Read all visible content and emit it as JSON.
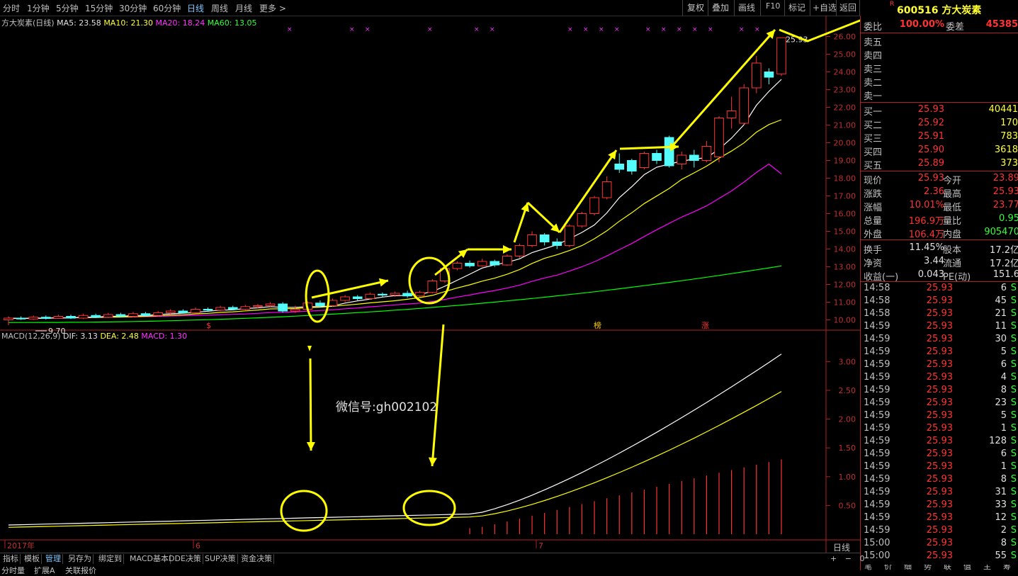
{
  "topbar": {
    "periods": [
      "分时",
      "1分钟",
      "5分钟",
      "15分钟",
      "30分钟",
      "60分钟",
      "日线",
      "周线",
      "月线",
      "更多 >"
    ],
    "active_period": "日线",
    "tools": [
      "复权",
      "叠加",
      "画线",
      "F10",
      "标记",
      "+自选",
      "返回"
    ],
    "stock_title": "600516 方大炭素",
    "r_marker": "R"
  },
  "price_legend": {
    "name": "方大炭素(日线)",
    "ma5": "MA5: 23.58",
    "ma10": "MA10: 21.30",
    "ma20": "MA20: 18.24",
    "ma60": "MA60: 13.05",
    "low_label": "9.70",
    "high_label": "25.93"
  },
  "macd_legend": {
    "name": "MACD(12,26,9)",
    "dif": "DIF: 3.13",
    "dea": "DEA: 2.48",
    "macd": "MACD: 1.30"
  },
  "price_axis": [
    "26.00",
    "25.00",
    "24.00",
    "23.00",
    "22.00",
    "21.00",
    "20.00",
    "19.00",
    "18.00",
    "17.00",
    "16.00",
    "15.00",
    "14.00",
    "13.00",
    "12.00",
    "11.00",
    "10.00"
  ],
  "macd_axis": [
    "3.00",
    "2.50",
    "2.00",
    "1.50",
    "1.00",
    "0.50"
  ],
  "date_labels": [
    "2017年",
    "6",
    "7"
  ],
  "period_corner": "日线",
  "event_markers": [
    "$",
    "榜",
    "涨"
  ],
  "watermark": "微信号:gh002102",
  "colors": {
    "up": "#ff3232",
    "down": "#54fcfc",
    "ma5": "#ffffff",
    "ma10": "#ffff00",
    "ma20": "#ff00ff",
    "ma60": "#00ff00",
    "annotation": "#ffff00"
  },
  "order_book": {
    "weibi_label": "委比",
    "weibi_value": "100.00%",
    "weicha_label": "委差",
    "weicha_value": "45385",
    "sell": [
      {
        "label": "卖五"
      },
      {
        "label": "卖四"
      },
      {
        "label": "卖三"
      },
      {
        "label": "卖二"
      },
      {
        "label": "卖一"
      }
    ],
    "buy": [
      {
        "label": "买一",
        "price": "25.93",
        "vol": "40441"
      },
      {
        "label": "买二",
        "price": "25.92",
        "vol": "170"
      },
      {
        "label": "买三",
        "price": "25.91",
        "vol": "783"
      },
      {
        "label": "买四",
        "price": "25.90",
        "vol": "3618"
      },
      {
        "label": "买五",
        "price": "25.89",
        "vol": "373"
      }
    ]
  },
  "quote": [
    {
      "l1": "现价",
      "v1": "25.93",
      "l2": "今开",
      "v2": "23.89"
    },
    {
      "l1": "涨跌",
      "v1": "2.36",
      "l2": "最高",
      "v2": "25.93"
    },
    {
      "l1": "涨幅",
      "v1": "10.01%",
      "l2": "最低",
      "v2": "23.77"
    },
    {
      "l1": "总量",
      "v1": "196.9万",
      "l2": "量比",
      "v2": "0.95"
    },
    {
      "l1": "外盘",
      "v1": "106.4万",
      "l2": "内盘",
      "v2": "905470"
    }
  ],
  "fundamentals": [
    {
      "l1": "换手",
      "v1": "11.45%",
      "l2": "股本",
      "v2": "17.2亿"
    },
    {
      "l1": "净资",
      "v1": "3.44",
      "l2": "流通",
      "v2": "17.2亿"
    },
    {
      "l1": "收益(一)",
      "v1": "0.043",
      "l2": "PE(动)",
      "v2": "151.6"
    }
  ],
  "ticks": [
    {
      "time": "14:58",
      "price": "25.93",
      "vol": "6",
      "side": "S"
    },
    {
      "time": "14:58",
      "price": "25.93",
      "vol": "45",
      "side": "S"
    },
    {
      "time": "14:58",
      "price": "25.93",
      "vol": "21",
      "side": "S"
    },
    {
      "time": "14:59",
      "price": "25.93",
      "vol": "11",
      "side": "S"
    },
    {
      "time": "14:59",
      "price": "25.93",
      "vol": "30",
      "side": "S"
    },
    {
      "time": "14:59",
      "price": "25.93",
      "vol": "5",
      "side": "S"
    },
    {
      "time": "14:59",
      "price": "25.93",
      "vol": "6",
      "side": "S"
    },
    {
      "time": "14:59",
      "price": "25.93",
      "vol": "4",
      "side": "S"
    },
    {
      "time": "14:59",
      "price": "25.93",
      "vol": "8",
      "side": "S"
    },
    {
      "time": "14:59",
      "price": "25.93",
      "vol": "23",
      "side": "S"
    },
    {
      "time": "14:59",
      "price": "25.93",
      "vol": "5",
      "side": "S"
    },
    {
      "time": "14:59",
      "price": "25.93",
      "vol": "1",
      "side": "S"
    },
    {
      "time": "14:59",
      "price": "25.93",
      "vol": "128",
      "side": "S"
    },
    {
      "time": "14:59",
      "price": "25.93",
      "vol": "6",
      "side": "S"
    },
    {
      "time": "14:59",
      "price": "25.93",
      "vol": "1",
      "side": "S"
    },
    {
      "time": "14:59",
      "price": "25.93",
      "vol": "8",
      "side": "S"
    },
    {
      "time": "14:59",
      "price": "25.93",
      "vol": "31",
      "side": "S"
    },
    {
      "time": "14:59",
      "price": "25.93",
      "vol": "33",
      "side": "S"
    },
    {
      "time": "14:59",
      "price": "25.93",
      "vol": "12",
      "side": "S"
    },
    {
      "time": "14:59",
      "price": "25.93",
      "vol": "2",
      "side": "S"
    },
    {
      "time": "15:00",
      "price": "25.93",
      "vol": "8",
      "side": "S"
    },
    {
      "time": "15:00",
      "price": "25.93",
      "vol": "55",
      "side": "S"
    }
  ],
  "bottom_tabs": [
    "指标",
    "模板",
    "管理",
    "另存为",
    "绑定到",
    "MACD基本",
    "DDE决策",
    "SUP决策",
    "资金决策"
  ],
  "bottom_active": "管理",
  "bottom_row2": [
    "分时量",
    "扩展A",
    "关联报价"
  ],
  "right_bottom_tabs": [
    "笔",
    "价",
    "细",
    "势",
    "联",
    "值",
    "主",
    "筹"
  ],
  "chart_data": {
    "type": "candlestick",
    "candles": [
      {
        "o": 10.0,
        "c": 10.1,
        "h": 10.2,
        "l": 9.7
      },
      {
        "o": 10.1,
        "c": 10.05,
        "h": 10.2,
        "l": 10.0
      },
      {
        "o": 10.05,
        "c": 10.15,
        "h": 10.25,
        "l": 10.0
      },
      {
        "o": 10.15,
        "c": 10.08,
        "h": 10.25,
        "l": 10.02
      },
      {
        "o": 10.08,
        "c": 10.2,
        "h": 10.3,
        "l": 10.05
      },
      {
        "o": 10.2,
        "c": 10.1,
        "h": 10.3,
        "l": 10.05
      },
      {
        "o": 10.1,
        "c": 10.25,
        "h": 10.35,
        "l": 10.05
      },
      {
        "o": 10.25,
        "c": 10.15,
        "h": 10.35,
        "l": 10.1
      },
      {
        "o": 10.15,
        "c": 10.3,
        "h": 10.4,
        "l": 10.1
      },
      {
        "o": 10.3,
        "c": 10.2,
        "h": 10.4,
        "l": 10.15
      },
      {
        "o": 10.2,
        "c": 10.35,
        "h": 10.45,
        "l": 10.15
      },
      {
        "o": 10.35,
        "c": 10.25,
        "h": 10.45,
        "l": 10.2
      },
      {
        "o": 10.25,
        "c": 10.4,
        "h": 10.5,
        "l": 10.2
      },
      {
        "o": 10.4,
        "c": 10.5,
        "h": 10.6,
        "l": 10.3
      },
      {
        "o": 10.5,
        "c": 10.4,
        "h": 10.6,
        "l": 10.35
      },
      {
        "o": 10.4,
        "c": 10.6,
        "h": 10.7,
        "l": 10.35
      },
      {
        "o": 10.6,
        "c": 10.55,
        "h": 10.7,
        "l": 10.45
      },
      {
        "o": 10.55,
        "c": 10.7,
        "h": 10.8,
        "l": 10.5
      },
      {
        "o": 10.7,
        "c": 10.6,
        "h": 10.8,
        "l": 10.55
      },
      {
        "o": 10.6,
        "c": 10.75,
        "h": 10.85,
        "l": 10.55
      },
      {
        "o": 10.75,
        "c": 10.8,
        "h": 10.9,
        "l": 10.65
      },
      {
        "o": 10.8,
        "c": 10.9,
        "h": 11.0,
        "l": 10.7
      },
      {
        "o": 10.9,
        "c": 10.5,
        "h": 11.0,
        "l": 10.4
      },
      {
        "o": 10.5,
        "c": 10.6,
        "h": 10.8,
        "l": 10.4
      },
      {
        "o": 10.6,
        "c": 10.95,
        "h": 11.05,
        "l": 10.55
      },
      {
        "o": 10.95,
        "c": 10.8,
        "h": 11.1,
        "l": 10.7
      },
      {
        "o": 10.8,
        "c": 11.1,
        "h": 11.2,
        "l": 10.75
      },
      {
        "o": 11.1,
        "c": 11.3,
        "h": 11.4,
        "l": 11.0
      },
      {
        "o": 11.3,
        "c": 11.2,
        "h": 11.4,
        "l": 11.1
      },
      {
        "o": 11.2,
        "c": 11.45,
        "h": 11.55,
        "l": 11.15
      },
      {
        "o": 11.45,
        "c": 11.4,
        "h": 11.55,
        "l": 11.3
      },
      {
        "o": 11.4,
        "c": 11.5,
        "h": 11.6,
        "l": 11.3
      },
      {
        "o": 11.5,
        "c": 11.35,
        "h": 11.65,
        "l": 11.25
      },
      {
        "o": 11.35,
        "c": 11.55,
        "h": 11.65,
        "l": 11.3
      },
      {
        "o": 11.55,
        "c": 12.2,
        "h": 12.3,
        "l": 11.5
      },
      {
        "o": 12.2,
        "c": 12.9,
        "h": 13.0,
        "l": 12.1
      },
      {
        "o": 12.9,
        "c": 13.2,
        "h": 13.3,
        "l": 12.8
      },
      {
        "o": 13.2,
        "c": 13.05,
        "h": 13.35,
        "l": 12.95
      },
      {
        "o": 13.05,
        "c": 13.3,
        "h": 13.45,
        "l": 13.0
      },
      {
        "o": 13.3,
        "c": 13.1,
        "h": 13.4,
        "l": 13.0
      },
      {
        "o": 13.1,
        "c": 13.6,
        "h": 13.7,
        "l": 13.05
      },
      {
        "o": 13.6,
        "c": 14.2,
        "h": 14.3,
        "l": 13.5
      },
      {
        "o": 14.2,
        "c": 14.8,
        "h": 15.0,
        "l": 14.1
      },
      {
        "o": 14.8,
        "c": 14.4,
        "h": 14.9,
        "l": 14.2
      },
      {
        "o": 14.4,
        "c": 14.2,
        "h": 14.6,
        "l": 14.0
      },
      {
        "o": 14.2,
        "c": 15.3,
        "h": 15.4,
        "l": 14.1
      },
      {
        "o": 15.3,
        "c": 16.0,
        "h": 16.1,
        "l": 15.2
      },
      {
        "o": 16.0,
        "c": 16.9,
        "h": 17.0,
        "l": 15.9
      },
      {
        "o": 16.9,
        "c": 17.8,
        "h": 18.1,
        "l": 16.8
      },
      {
        "o": 18.8,
        "c": 18.5,
        "h": 19.4,
        "l": 18.3
      },
      {
        "o": 19.0,
        "c": 18.4,
        "h": 19.1,
        "l": 18.2
      },
      {
        "o": 18.6,
        "c": 19.4,
        "h": 19.5,
        "l": 18.5
      },
      {
        "o": 19.4,
        "c": 19.0,
        "h": 19.6,
        "l": 18.8
      },
      {
        "o": 20.3,
        "c": 18.7,
        "h": 20.4,
        "l": 18.6
      },
      {
        "o": 18.8,
        "c": 19.3,
        "h": 19.5,
        "l": 18.5
      },
      {
        "o": 19.3,
        "c": 19.0,
        "h": 19.6,
        "l": 18.6
      },
      {
        "o": 19.0,
        "c": 19.8,
        "h": 20.1,
        "l": 18.9
      },
      {
        "o": 19.2,
        "c": 21.4,
        "h": 21.5,
        "l": 18.9
      },
      {
        "o": 21.4,
        "c": 21.8,
        "h": 22.6,
        "l": 20.8
      },
      {
        "o": 21.1,
        "c": 23.1,
        "h": 23.3,
        "l": 21.0
      },
      {
        "o": 23.1,
        "c": 24.5,
        "h": 24.9,
        "l": 22.8
      },
      {
        "o": 24.0,
        "c": 23.7,
        "h": 24.2,
        "l": 23.3
      },
      {
        "o": 23.89,
        "c": 25.93,
        "h": 25.93,
        "l": 23.77
      }
    ],
    "ma5_last": 23.58,
    "ma10_last": 21.3,
    "ma20_last": 18.24,
    "ma60_last": 13.05,
    "macd_last": {
      "dif": 3.13,
      "dea": 2.48,
      "macd": 1.3
    },
    "price_range": [
      9.5,
      26.3
    ],
    "macd_range": [
      0,
      3.3
    ]
  }
}
